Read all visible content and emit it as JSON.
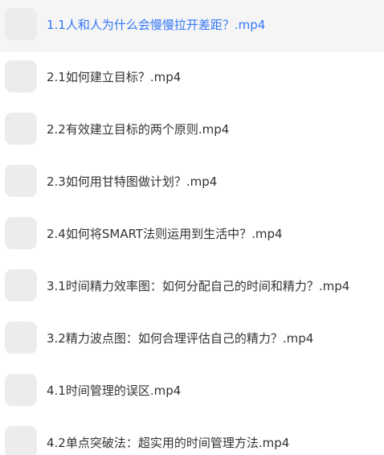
{
  "playlist": {
    "active_color": "#3478f6",
    "text_color": "#333333",
    "items": [
      {
        "label": "1.1人和人为什么会慢慢拉开差距？.mp4",
        "active": true
      },
      {
        "label": "2.1如何建立目标？.mp4",
        "active": false
      },
      {
        "label": "2.2有效建立目标的两个原则.mp4",
        "active": false
      },
      {
        "label": "2.3如何用甘特图做计划？.mp4",
        "active": false
      },
      {
        "label": "2.4如何将SMART法则运用到生活中？.mp4",
        "active": false
      },
      {
        "label": "3.1时间精力效率图：如何分配自己的时间和精力？.mp4",
        "active": false
      },
      {
        "label": "3.2精力波点图：如何合理评估自己的精力？.mp4",
        "active": false
      },
      {
        "label": "4.1时间管理的误区.mp4",
        "active": false
      },
      {
        "label": "4.2单点突破法：超实用的时间管理方法.mp4",
        "active": false
      }
    ]
  }
}
